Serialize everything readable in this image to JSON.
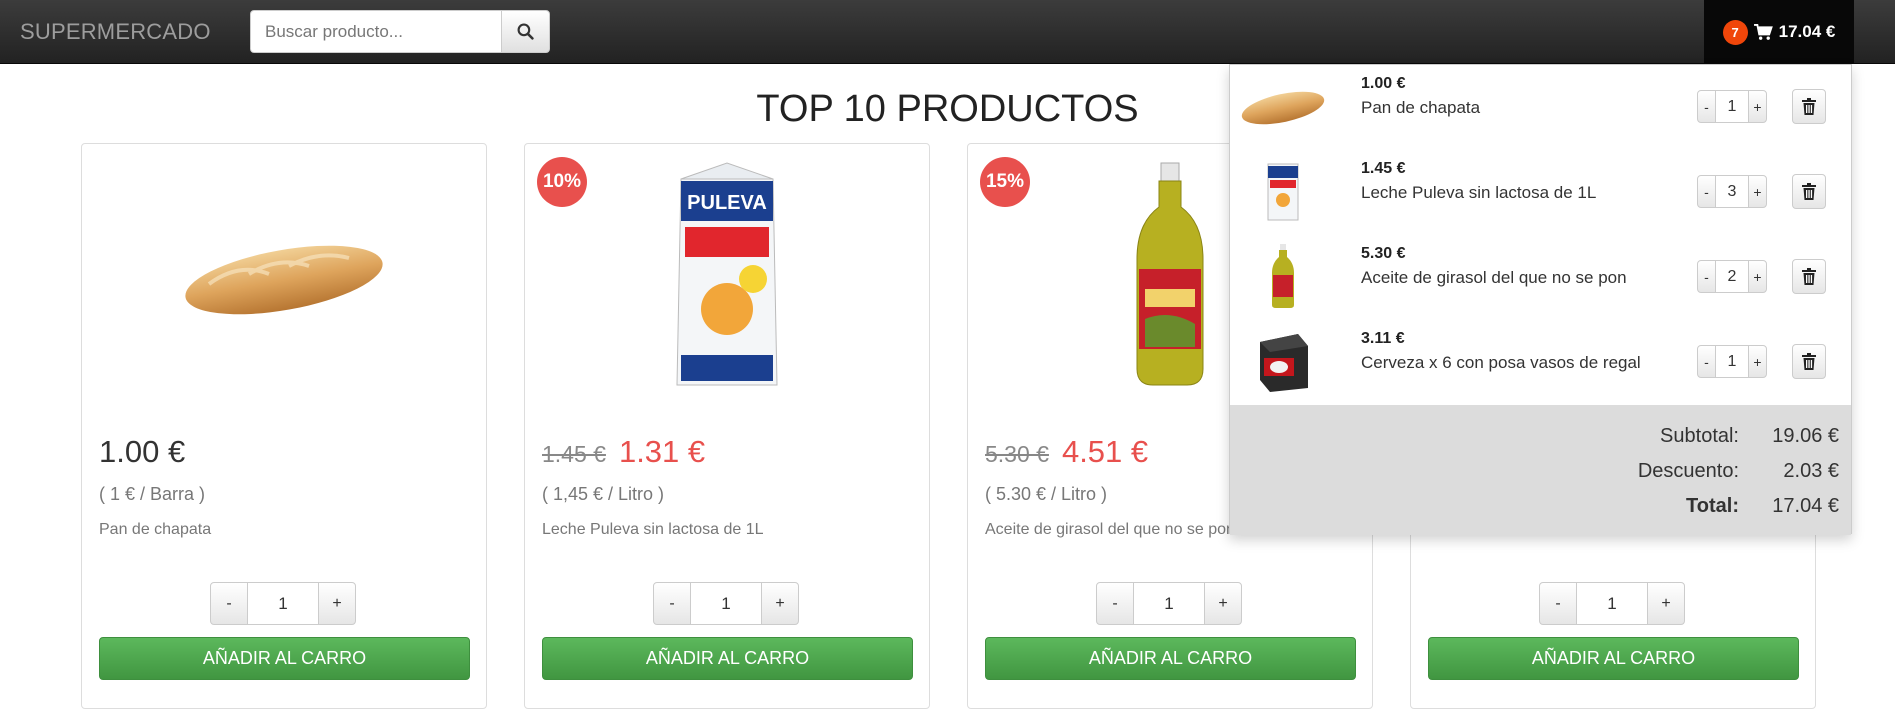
{
  "navbar": {
    "brand": "SUPERMERCADO",
    "search_placeholder": "Buscar producto...",
    "cart_count": "7",
    "cart_total": "17.04 €"
  },
  "page_title": "TOP 10 PRODUCTOS",
  "products": [
    {
      "discount": "",
      "old_price": "",
      "price": "1.00 €",
      "unit": "( 1 € / Barra )",
      "name": "Pan de chapata",
      "qty": "1",
      "add_label": "AÑADIR AL CARRO",
      "minus": "-",
      "plus": "+"
    },
    {
      "discount": "10%",
      "old_price": "1.45 €",
      "price": "1.31 €",
      "unit": "( 1,45 € / Litro )",
      "name": "Leche Puleva sin lactosa de 1L",
      "qty": "1",
      "add_label": "AÑADIR AL CARRO",
      "minus": "-",
      "plus": "+"
    },
    {
      "discount": "15%",
      "old_price": "5.30 €",
      "price": "4.51 €",
      "unit": "( 5.30 € / Litro )",
      "name": "Aceite de girasol del que no se pon",
      "qty": "1",
      "add_label": "AÑADIR AL CARRO",
      "minus": "-",
      "plus": "+"
    },
    {
      "discount": "",
      "old_price": "",
      "price": "",
      "unit": "",
      "name": "",
      "qty": "1",
      "add_label": "AÑADIR AL CARRO",
      "minus": "-",
      "plus": "+"
    }
  ],
  "cart": {
    "items": [
      {
        "price": "1.00 €",
        "name": "Pan de chapata",
        "qty": "1",
        "minus": "-",
        "plus": "+"
      },
      {
        "price": "1.45 €",
        "name": "Leche Puleva sin lactosa de 1L",
        "qty": "3",
        "minus": "-",
        "plus": "+"
      },
      {
        "price": "5.30 €",
        "name": "Aceite de girasol del que no se pon",
        "qty": "2",
        "minus": "-",
        "plus": "+"
      },
      {
        "price": "3.11 €",
        "name": "Cerveza x 6 con posa vasos de regal",
        "qty": "1",
        "minus": "-",
        "plus": "+"
      }
    ],
    "subtotal_label": "Subtotal:",
    "subtotal": "19.06 €",
    "discount_label": "Descuento:",
    "discount": "2.03 €",
    "total_label": "Total:",
    "total": "17.04 €"
  },
  "colors": {
    "accent_red": "#e8504d",
    "green": "#4cae4c",
    "badge": "#f0460a"
  },
  "icons": [
    "search-icon",
    "cart-icon",
    "trash-icon"
  ]
}
